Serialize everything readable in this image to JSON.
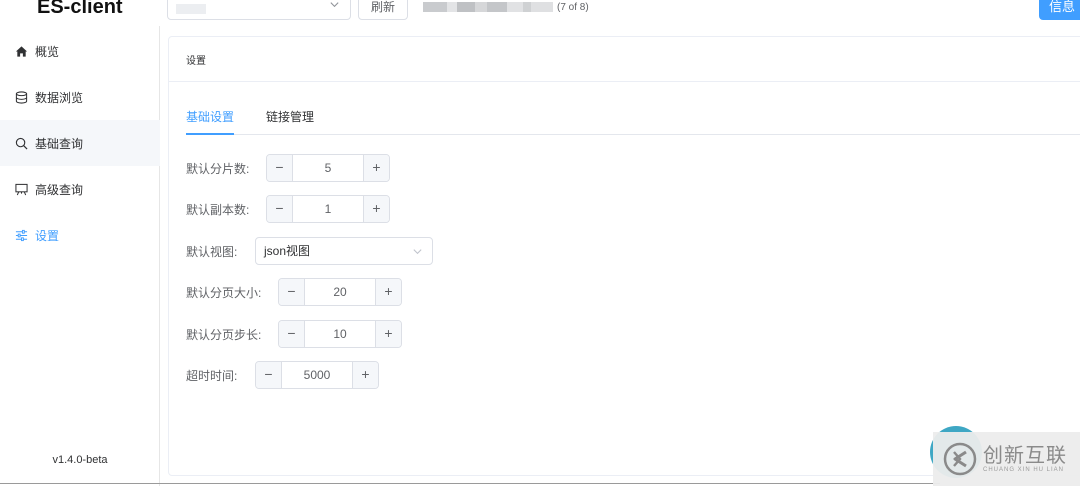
{
  "app": {
    "title": "ES-client",
    "version": "v1.4.0-beta"
  },
  "topbar": {
    "connection_select": {
      "value": ""
    },
    "refresh_label": "刷新",
    "cluster_count": "(7 of 8)",
    "info_label": "信息"
  },
  "sidebar": {
    "items": [
      {
        "label": "概览",
        "icon": "home-icon"
      },
      {
        "label": "数据浏览",
        "icon": "database-icon"
      },
      {
        "label": "基础查询",
        "icon": "search-icon"
      },
      {
        "label": "高级查询",
        "icon": "board-icon"
      },
      {
        "label": "设置",
        "icon": "sliders-icon"
      }
    ],
    "active": "设置"
  },
  "card": {
    "title": "设置"
  },
  "tabs": [
    {
      "label": "基础设置",
      "active": true
    },
    {
      "label": "链接管理",
      "active": false
    }
  ],
  "form": {
    "shards": {
      "label": "默认分片数:",
      "value": "5"
    },
    "replicas": {
      "label": "默认副本数:",
      "value": "1"
    },
    "view": {
      "label": "默认视图:",
      "value": "json视图"
    },
    "page_size": {
      "label": "默认分页大小:",
      "value": "20"
    },
    "page_step": {
      "label": "默认分页步长:",
      "value": "10"
    },
    "timeout": {
      "label": "超时时间:",
      "value": "5000"
    }
  },
  "stepper_symbols": {
    "minus": "−",
    "plus": "+"
  },
  "watermark": {
    "title": "创新互联",
    "subtitle": "CHUANG XIN HU LIAN"
  },
  "colors": {
    "accent": "#409eff",
    "border": "#dcdfe6",
    "float_button": "#3ea7c4"
  }
}
